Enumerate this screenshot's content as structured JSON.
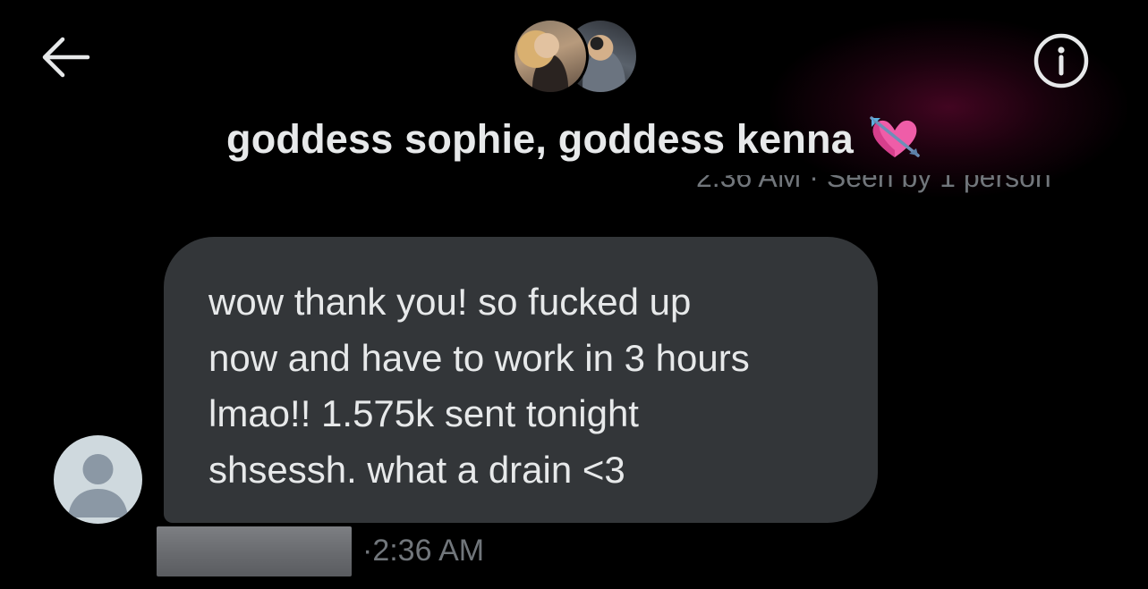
{
  "header": {
    "title": "goddess sophie, goddess kenna",
    "title_emoji_name": "heart-with-arrow-icon",
    "back_icon": "arrow-left-icon",
    "info_icon": "info-icon",
    "avatars": [
      "group-avatar-1",
      "group-avatar-2"
    ]
  },
  "seen_status": {
    "text": "2:36 AM · Seen by 1 person"
  },
  "message": {
    "lines": [
      "wow thank you! so fucked up",
      "now and have to work in 3 hours",
      "lmao!! 1.575k sent tonight",
      "shsessh. what a drain <3"
    ],
    "sender_redacted": true,
    "separator": "·",
    "time": "2:36 AM"
  },
  "colors": {
    "background": "#000000",
    "bubble": "#333639",
    "text_primary": "#e7e9ea",
    "text_secondary": "#71767b",
    "default_avatar": "#cfd9de",
    "accent_glow": "#780a3c"
  }
}
